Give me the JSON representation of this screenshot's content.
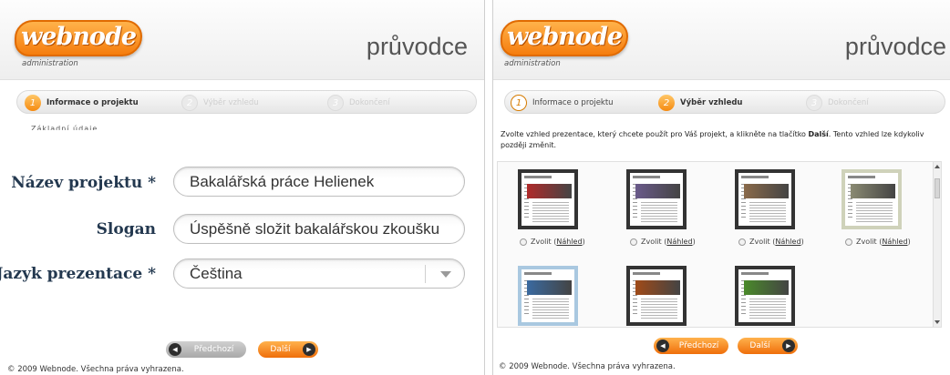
{
  "left": {
    "logo_text": "webnode",
    "logo_sub": "administration",
    "guide_title": "průvodce",
    "steps": [
      {
        "num": "1",
        "label": "Informace o projektu"
      },
      {
        "num": "2",
        "label": "Výběr vzhledu"
      },
      {
        "num": "3",
        "label": "Dokončení"
      }
    ],
    "cut_text": "Základní údaje",
    "fields": {
      "name_label": "Název projektu *",
      "name_value": "Bakalářská práce Helienek",
      "slogan_label": "Slogan",
      "slogan_value": "Úspěšně složit bakalářskou zkoušku",
      "lang_label": "Jazyk prezentace *",
      "lang_value": "Čeština"
    },
    "prev_button": "Předchozí",
    "next_button": "Další",
    "footer": "© 2009 Webnode. Všechna práva vyhrazena."
  },
  "right": {
    "logo_text": "webnode",
    "logo_sub": "administration",
    "guide_title": "průvodce",
    "steps": [
      {
        "num": "1",
        "label": "Informace o projektu"
      },
      {
        "num": "2",
        "label": "Výběr vzhledu"
      },
      {
        "num": "3",
        "label": "Dokončení"
      }
    ],
    "instruction_pre": "Zvolte vzhled prezentace, který chcete použít pro Váš projekt, a klikněte na tlačítko ",
    "instruction_bold": "Další",
    "instruction_post": ". Tento vzhled lze kdykoliv později změnit.",
    "choose_label": "Zvolit",
    "preview_label": "Náhled",
    "templates": [
      {
        "banner_color": "#b02a2a"
      },
      {
        "banner_color": "#6a5a8a"
      },
      {
        "banner_color": "#8a6a4a"
      },
      {
        "banner_color": "#8a8a72"
      },
      {
        "banner_color": "#3a6aa0"
      },
      {
        "banner_color": "#a04a18"
      },
      {
        "banner_color": "#4a8a2a"
      }
    ],
    "prev_button": "Předchozí",
    "next_button": "Další",
    "footer": "© 2009 Webnode. Všechna práva vyhrazena."
  },
  "colors": {
    "accent_orange": "#f58a10",
    "label_navy": "#23384f"
  }
}
